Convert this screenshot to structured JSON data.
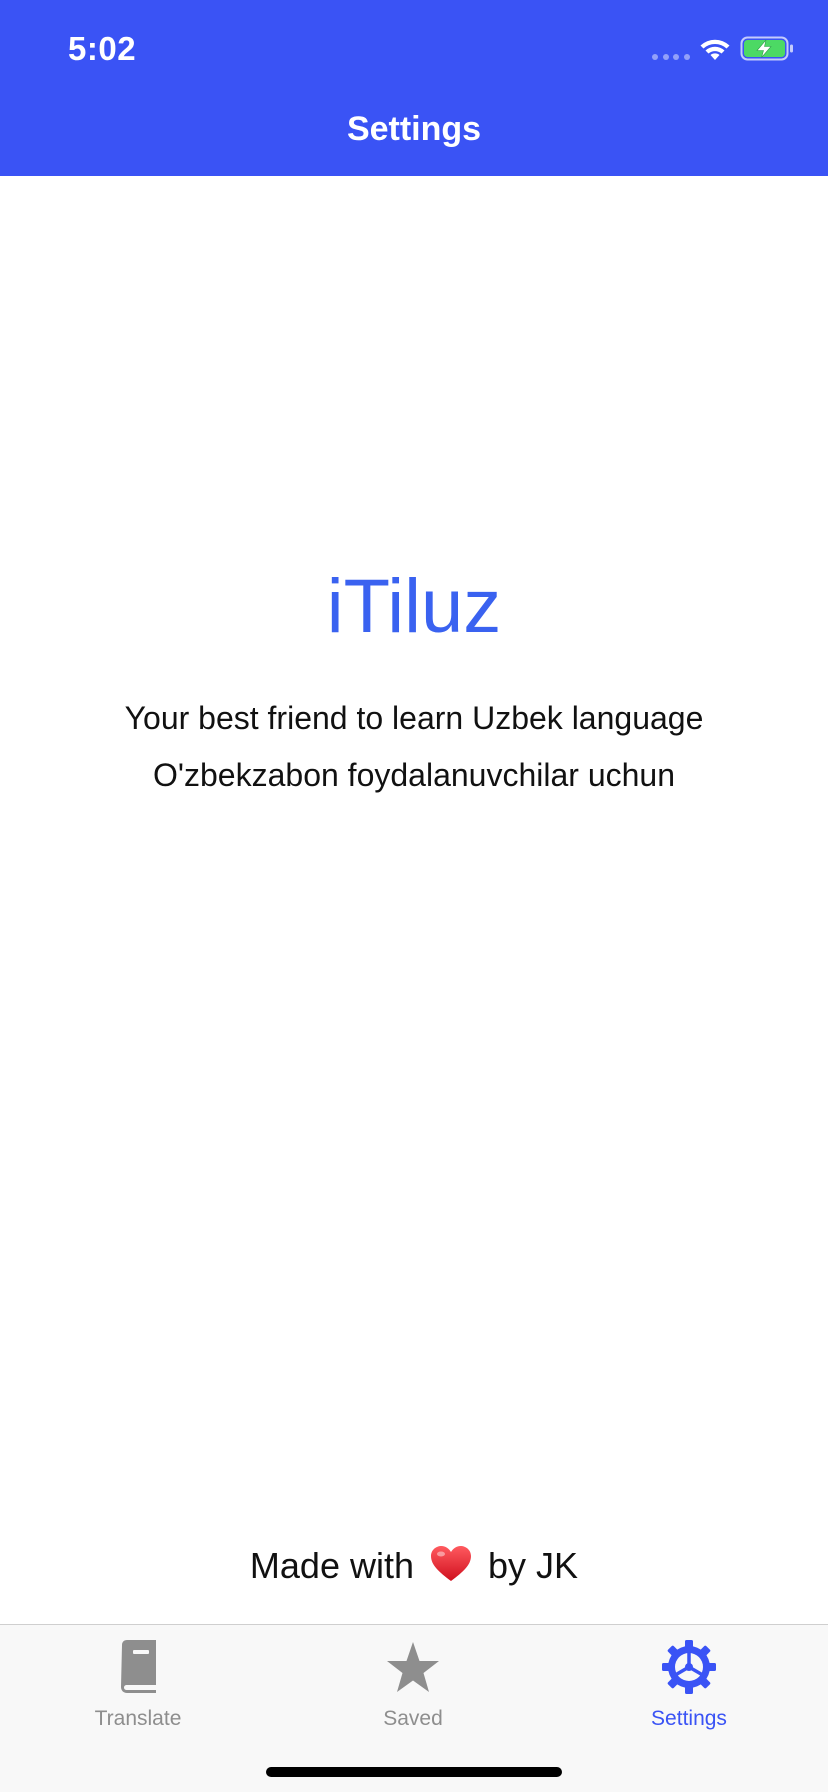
{
  "status_bar": {
    "time": "5:02"
  },
  "nav": {
    "title": "Settings"
  },
  "content": {
    "app_name": "iTiluz",
    "tagline_en": "Your best friend to learn Uzbek language",
    "tagline_uz": "O'zbekzabon foydalanuvchilar uchun"
  },
  "footer": {
    "made_with": "Made with",
    "by_author": "by JK",
    "heart_icon": "heart-icon"
  },
  "tabs": [
    {
      "label": "Translate",
      "icon": "book-icon",
      "active": false
    },
    {
      "label": "Saved",
      "icon": "star-icon",
      "active": false
    },
    {
      "label": "Settings",
      "icon": "gear-icon",
      "active": true
    }
  ],
  "colors": {
    "header_bg": "#3A53F5",
    "accent": "#3A62F0",
    "tab_inactive": "#8E8E8E",
    "tab_active": "#3A53F5",
    "heart": "#E02030",
    "battery_fill": "#4CD964"
  }
}
